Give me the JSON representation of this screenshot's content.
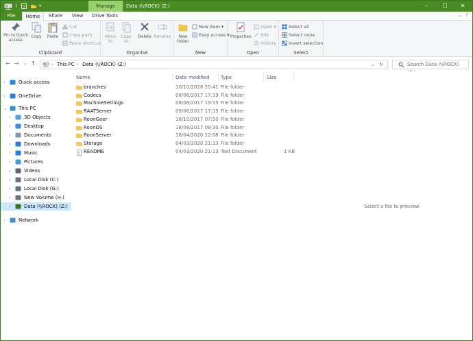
{
  "window": {
    "title": "Data (\\\\ROCK) (Z:)",
    "manage_tab": "Manage",
    "minimize": "–",
    "maximize": "☐",
    "close": "✕"
  },
  "ribbon_tabs": [
    {
      "label": "File"
    },
    {
      "label": "Home"
    },
    {
      "label": "Share"
    },
    {
      "label": "View"
    },
    {
      "label": "Drive Tools"
    }
  ],
  "ribbon": {
    "clipboard": {
      "label": "Clipboard",
      "pin": "Pin to Quick access",
      "pin_l1": "Pin to Quick",
      "pin_l2": "access",
      "copy": "Copy",
      "paste": "Paste",
      "cut": "Cut",
      "copy_path": "Copy path",
      "paste_shortcut": "Paste shortcut"
    },
    "organise": {
      "label": "Organise",
      "move_l1": "Move",
      "move_l2": "to",
      "copy_l1": "Copy",
      "copy_l2": "to",
      "delete": "Delete",
      "rename": "Rename"
    },
    "new": {
      "label": "New",
      "folder_l1": "New",
      "folder_l2": "folder",
      "new_item": "New item",
      "easy_access": "Easy access"
    },
    "open": {
      "label": "Open",
      "properties": "Properties",
      "open": "Open",
      "edit": "Edit",
      "history": "History"
    },
    "select": {
      "label": "Select",
      "select_all": "Select all",
      "select_none": "Select none",
      "invert": "Invert selection"
    }
  },
  "address": {
    "crumbs": [
      "This PC",
      "Data (\\\\ROCK) (Z:)"
    ],
    "search_placeholder": "Search Data (\\\\ROCK) (Z:)"
  },
  "nav": [
    {
      "label": "Quick access",
      "icon": "star-icon",
      "color": "#2f86d4",
      "level": 0,
      "chev": ">"
    },
    {
      "label": "OneDrive",
      "icon": "cloud-icon",
      "color": "#2a7fd4",
      "level": 0,
      "chev": ">"
    },
    {
      "label": "This PC",
      "icon": "computer-icon",
      "color": "#3b8fd0",
      "level": 0,
      "chev": "v"
    },
    {
      "label": "3D Objects",
      "icon": "cube-icon",
      "color": "#5aa0d8",
      "level": 1,
      "chev": ">"
    },
    {
      "label": "Desktop",
      "icon": "desktop-icon",
      "color": "#3a8ed3",
      "level": 1,
      "chev": ">"
    },
    {
      "label": "Documents",
      "icon": "documents-icon",
      "color": "#8a95a5",
      "level": 1,
      "chev": ">"
    },
    {
      "label": "Downloads",
      "icon": "download-icon",
      "color": "#2a7fd4",
      "level": 1,
      "chev": ">"
    },
    {
      "label": "Music",
      "icon": "music-icon",
      "color": "#2a7fd4",
      "level": 1,
      "chev": ">"
    },
    {
      "label": "Pictures",
      "icon": "pictures-icon",
      "color": "#4a9bd8",
      "level": 1,
      "chev": ">"
    },
    {
      "label": "Videos",
      "icon": "videos-icon",
      "color": "#5a6475",
      "level": 1,
      "chev": ">"
    },
    {
      "label": "Local Disk (C:)",
      "icon": "drive-icon",
      "color": "#6b7280",
      "level": 1,
      "chev": ">"
    },
    {
      "label": "Local Disk (G:)",
      "icon": "drive-icon",
      "color": "#6b7280",
      "level": 1,
      "chev": ">"
    },
    {
      "label": "New Volume (H:)",
      "icon": "drive-icon",
      "color": "#6b7280",
      "level": 1,
      "chev": ">"
    },
    {
      "label": "Data (\\\\ROCK) (Z:)",
      "icon": "network-drive-icon",
      "color": "#3a7a1e",
      "level": 1,
      "chev": ">",
      "selected": true
    },
    {
      "label": "Network",
      "icon": "network-icon",
      "color": "#3b8fd0",
      "level": 0,
      "chev": ">"
    }
  ],
  "columns": {
    "name": "Name",
    "date": "Date modified",
    "type": "Type",
    "size": "Size"
  },
  "files": [
    {
      "name": "branches",
      "date": "10/10/2018 20:41",
      "type": "File folder",
      "size": "",
      "kind": "folder"
    },
    {
      "name": "Codecs",
      "date": "08/06/2017 17:19",
      "type": "File folder",
      "size": "",
      "kind": "folder"
    },
    {
      "name": "MachineSettings",
      "date": "08/06/2017 19:15",
      "type": "File folder",
      "size": "",
      "kind": "folder"
    },
    {
      "name": "RAATServer",
      "date": "08/06/2017 17:15",
      "type": "File folder",
      "size": "",
      "kind": "folder"
    },
    {
      "name": "RoonGoer",
      "date": "18/10/2017 07:50",
      "type": "File folder",
      "size": "",
      "kind": "folder"
    },
    {
      "name": "RoonOS",
      "date": "18/08/2017 08:30",
      "type": "File folder",
      "size": "",
      "kind": "folder"
    },
    {
      "name": "RoonServer",
      "date": "18/04/2020 12:08",
      "type": "File folder",
      "size": "",
      "kind": "folder"
    },
    {
      "name": "Storage",
      "date": "04/03/2020 21:13",
      "type": "File folder",
      "size": "",
      "kind": "folder"
    },
    {
      "name": "README",
      "date": "04/03/2020 21:13",
      "type": "Text Document",
      "size": "1 KB",
      "kind": "text"
    }
  ],
  "preview": {
    "message": "Select a file to preview."
  },
  "colors": {
    "titlebar": "#4a8a22",
    "manage_tab": "#9bd06f",
    "selection": "#cce8ff",
    "folder": "#f3c64e"
  }
}
